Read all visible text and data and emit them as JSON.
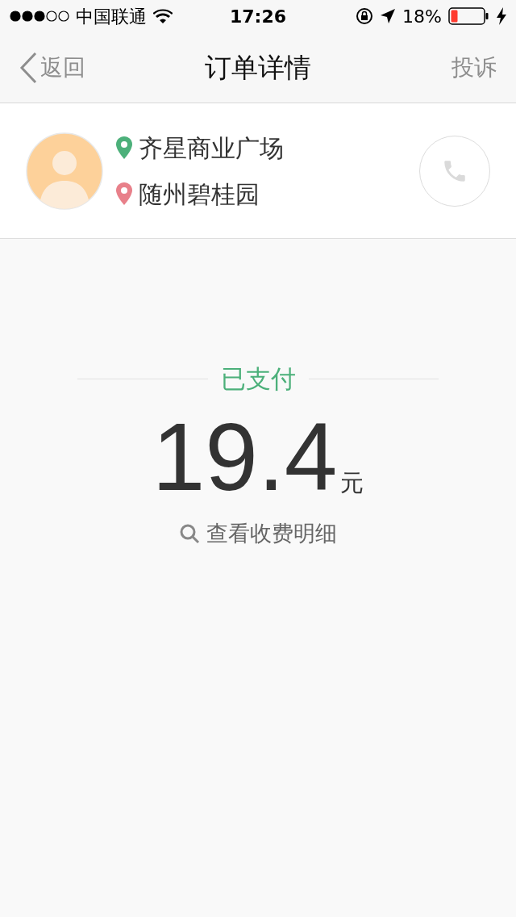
{
  "status_bar": {
    "carrier": "中国联通",
    "time": "17:26",
    "battery": "18%"
  },
  "nav": {
    "back": "返回",
    "title": "订单详情",
    "action": "投诉"
  },
  "trip": {
    "locations": [
      {
        "name": "齐星商业广场",
        "color": "#4cb07a"
      },
      {
        "name": "随州碧桂园",
        "color": "#e8808a"
      }
    ]
  },
  "payment": {
    "status": "已支付",
    "amount": "19.4",
    "unit": "元",
    "details_link": "查看收费明细"
  }
}
